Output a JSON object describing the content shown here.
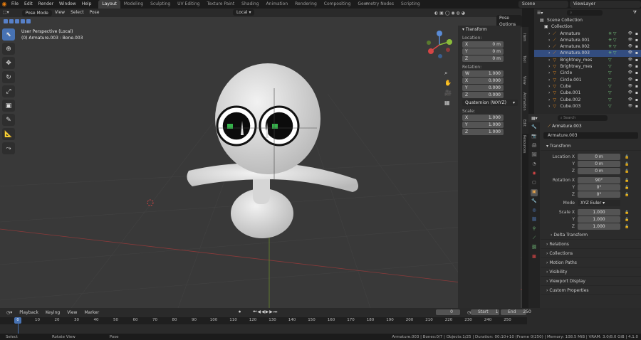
{
  "menu": [
    "File",
    "Edit",
    "Render",
    "Window",
    "Help"
  ],
  "workspaces": [
    "Layout",
    "Modeling",
    "Sculpting",
    "UV Editing",
    "Texture Paint",
    "Shading",
    "Animation",
    "Rendering",
    "Compositing",
    "Geometry Nodes",
    "Scripting"
  ],
  "active_workspace": "Layout",
  "scene": "Scene",
  "view_layer": "ViewLayer",
  "viewport": {
    "mode": "Pose Mode",
    "menus": [
      "View",
      "Select",
      "Pose"
    ],
    "orientation": "Local",
    "options": "Pose Options",
    "overlay_line1": "User Perspective (Local)",
    "overlay_line2": "(0) Armature.003 : Bone.003",
    "gizmo_z": "Z",
    "gizmo_y": "Y",
    "gizmo_x": "X"
  },
  "npanel": {
    "header": "Transform",
    "location_label": "Location:",
    "location": [
      {
        "k": "X",
        "v": "0 m"
      },
      {
        "k": "Y",
        "v": "0 m"
      },
      {
        "k": "Z",
        "v": "0 m"
      }
    ],
    "rotation_label": "Rotation:",
    "rotation": [
      {
        "k": "W",
        "v": "1.000"
      },
      {
        "k": "X",
        "v": "0.000"
      },
      {
        "k": "Y",
        "v": "0.000"
      },
      {
        "k": "Z",
        "v": "0.000"
      }
    ],
    "rotation_mode": "Quaternion (WXYZ)",
    "scale_label": "Scale:",
    "scale": [
      {
        "k": "X",
        "v": "1.000"
      },
      {
        "k": "Y",
        "v": "1.000"
      },
      {
        "k": "Z",
        "v": "1.000"
      }
    ],
    "tabs": [
      "Item",
      "Tool",
      "View",
      "Animation",
      "Edit",
      "Resources"
    ]
  },
  "outliner": {
    "search_placeholder": "",
    "root": "Scene Collection",
    "collection": "Collection",
    "items": [
      {
        "name": "Armature",
        "sel": false
      },
      {
        "name": "Armature.001",
        "sel": false
      },
      {
        "name": "Armature.002",
        "sel": false
      },
      {
        "name": "Armature.003",
        "sel": true
      },
      {
        "name": "Brightney_mesh",
        "sel": false
      },
      {
        "name": "Brightney_mesh.001",
        "sel": false
      },
      {
        "name": "Circle",
        "sel": false
      },
      {
        "name": "Circle.001",
        "sel": false
      },
      {
        "name": "Cube",
        "sel": false
      },
      {
        "name": "Cube.001",
        "sel": false
      },
      {
        "name": "Cube.002",
        "sel": false
      },
      {
        "name": "Cube.003",
        "sel": false
      }
    ]
  },
  "properties": {
    "search_placeholder": "Search",
    "object_name": "Armature.003",
    "object_field": "Armature.003",
    "transform_header": "Transform",
    "location": [
      {
        "k": "Location X",
        "v": "0 m"
      },
      {
        "k": "Y",
        "v": "0 m"
      },
      {
        "k": "Z",
        "v": "0 m"
      }
    ],
    "rotation": [
      {
        "k": "Rotation X",
        "v": "90°"
      },
      {
        "k": "Y",
        "v": "0°"
      },
      {
        "k": "Z",
        "v": "0°"
      }
    ],
    "mode_label": "Mode",
    "mode_value": "XYZ Euler",
    "scale": [
      {
        "k": "Scale X",
        "v": "1.000"
      },
      {
        "k": "Y",
        "v": "1.000"
      },
      {
        "k": "Z",
        "v": "1.000"
      }
    ],
    "delta": "Delta Transform",
    "sections": [
      "Relations",
      "Collections",
      "Motion Paths",
      "Visibility",
      "Viewport Display",
      "Custom Properties"
    ]
  },
  "timeline": {
    "menus": [
      "Playback",
      "Keying",
      "View",
      "Marker"
    ],
    "current_frame": "0",
    "start_label": "Start",
    "start": "1",
    "end_label": "End",
    "end": "250",
    "ticks": [
      "0",
      "10",
      "20",
      "30",
      "40",
      "50",
      "60",
      "70",
      "80",
      "90",
      "100",
      "110",
      "120",
      "130",
      "140",
      "150",
      "160",
      "170",
      "180",
      "190",
      "200",
      "210",
      "220",
      "230",
      "240",
      "250"
    ],
    "playhead": "0"
  },
  "status": {
    "left": "Select",
    "mid": "Rotate View",
    "right2": "Pose",
    "info": "Armature.003 | Bones:0/7 | Objects:1/25 | Duration: 00:10+10 (Frame 0/250) | Memory: 108.5 MiB | VRAM: 3.0/8.0 GiB | 4.1.0"
  },
  "colors": {
    "accent": "#4772b3",
    "selected_row": "#334d80",
    "orange": "#e87d0d",
    "viewport_bg": "#393939"
  }
}
